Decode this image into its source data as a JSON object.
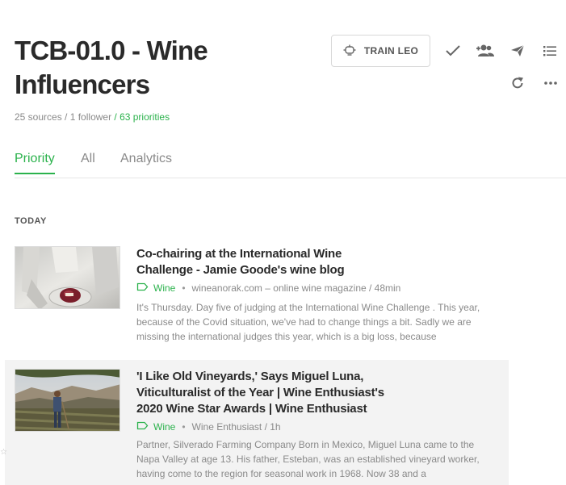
{
  "header": {
    "title": "TCB-01.0 - Wine Influencers",
    "sources": "25 sources",
    "separator1": " / ",
    "followers": "1 follower",
    "priorities": " / 63 priorities"
  },
  "toolbar": {
    "train_label": "TRAIN LEO"
  },
  "tabs": [
    {
      "label": "Priority",
      "active": true
    },
    {
      "label": "All",
      "active": false
    },
    {
      "label": "Analytics",
      "active": false
    }
  ],
  "section_label": "TODAY",
  "articles": [
    {
      "title": "Co-chairing at the International Wine Challenge - Jamie Goode's wine blog",
      "feed": "Wine",
      "source": "wineanorak.com – online wine magazine / 48min",
      "summary": "It's Thursday. Day five of judging at the International Wine Challenge . This year, because of the Covid situation, we've had to change things a bit. Sadly we are missing the international judges this year, which is a big loss, because"
    },
    {
      "title": "'I Like Old Vineyards,' Says Miguel Luna, Viticulturalist of the Year | Wine Enthusiast's 2020 Wine Star Awards | Wine Enthusiast",
      "feed": "Wine",
      "source": "Wine Enthusiast / 1h",
      "summary": "Partner, Silverado Farming Company Born in Mexico, Miguel Luna came to the Napa Valley at age 13. His father, Esteban, was an established vineyard worker, having come to the region for seasonal work in 1968. Now 38 and a"
    }
  ],
  "colors": {
    "accent": "#2bb24c",
    "text": "#2a2a2a",
    "muted": "#8a8a8a"
  }
}
